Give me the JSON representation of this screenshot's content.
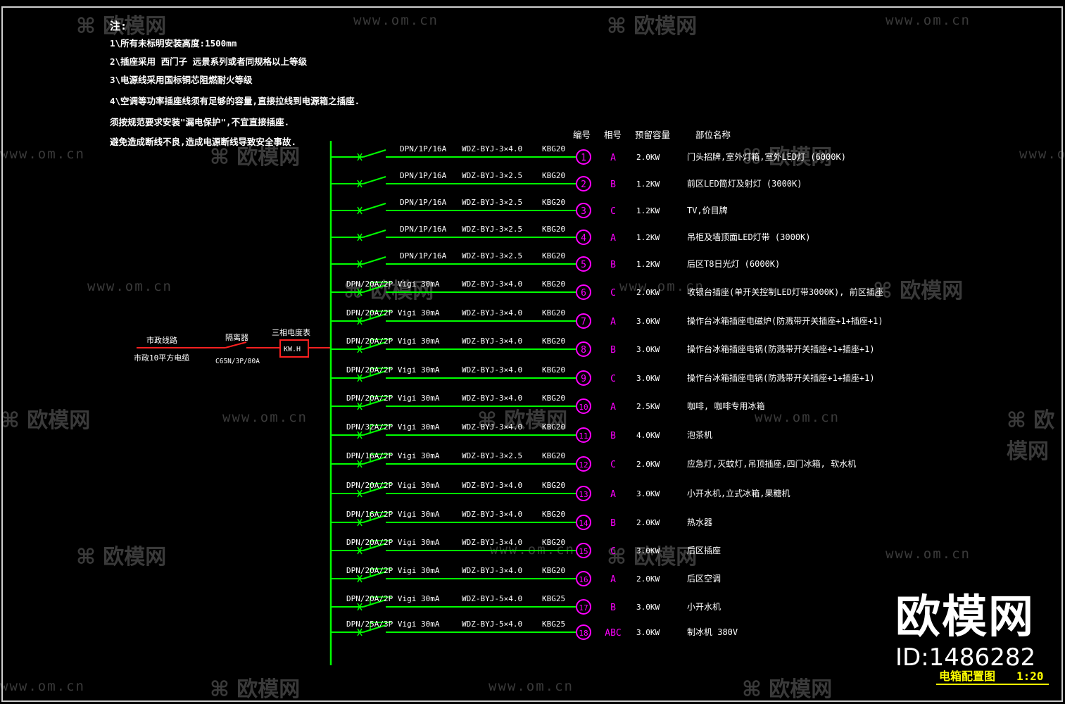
{
  "notes": {
    "heading": "注:",
    "lines": [
      "1\\所有未标明安装高度:1500mm",
      "2\\插座采用 西门子 远景系列或者同规格以上等级",
      "3\\电源线采用国标铜芯阻燃耐火等级",
      "4\\空调等功率插座线须有足够的容量,直接拉线到电源箱之插座.",
      "须按规范要求安装\"漏电保护\",不宜直接插座.",
      "避免造成断线不良,造成电源断线导致安全事故."
    ]
  },
  "headers": {
    "number": "编号",
    "phase": "相号",
    "capacity": "预留容量",
    "location": "部位名称"
  },
  "incoming": {
    "source_line1": "市政线路",
    "source_line2": "市政10平方电缆",
    "isolator": "隔离器",
    "isolator_spec": "C65N/3P/80A",
    "meter_label": "三相电度表",
    "meter_box": "KW.H"
  },
  "circuits": [
    {
      "breaker": "DPN/1P/16A",
      "cable": "WDZ-BYJ-3×4.0",
      "conduit": "KBG20",
      "num": "1",
      "phase": "A",
      "cap": "2.0KW",
      "desc": "门头招牌,室外灯箱,室外LED灯 (6000K)"
    },
    {
      "breaker": "DPN/1P/16A",
      "cable": "WDZ-BYJ-3×2.5",
      "conduit": "KBG20",
      "num": "2",
      "phase": "B",
      "cap": "1.2KW",
      "desc": "前区LED筒灯及射灯 (3000K)"
    },
    {
      "breaker": "DPN/1P/16A",
      "cable": "WDZ-BYJ-3×2.5",
      "conduit": "KBG20",
      "num": "3",
      "phase": "C",
      "cap": "1.2KW",
      "desc": "TV,价目牌"
    },
    {
      "breaker": "DPN/1P/16A",
      "cable": "WDZ-BYJ-3×2.5",
      "conduit": "KBG20",
      "num": "4",
      "phase": "A",
      "cap": "1.2KW",
      "desc": "吊柜及墙顶面LED灯带 (3000K)"
    },
    {
      "breaker": "DPN/1P/16A",
      "cable": "WDZ-BYJ-3×2.5",
      "conduit": "KBG20",
      "num": "5",
      "phase": "B",
      "cap": "1.2KW",
      "desc": "后区T8日光灯 (6000K)"
    },
    {
      "breaker": "DPN/20A/2P Vigi 30mA",
      "cable": "WDZ-BYJ-3×4.0",
      "conduit": "KBG20",
      "num": "6",
      "phase": "C",
      "cap": "2.0KW",
      "desc": "收银台插座(单开关控制LED灯带3000K), 前区插座"
    },
    {
      "breaker": "DPN/20A/2P Vigi 30mA",
      "cable": "WDZ-BYJ-3×4.0",
      "conduit": "KBG20",
      "num": "7",
      "phase": "A",
      "cap": "3.0KW",
      "desc": "操作台冰箱插座电磁炉(防溅带开关插座+1+插座+1)"
    },
    {
      "breaker": "DPN/20A/2P Vigi 30mA",
      "cable": "WDZ-BYJ-3×4.0",
      "conduit": "KBG20",
      "num": "8",
      "phase": "B",
      "cap": "3.0KW",
      "desc": "操作台冰箱插座电锅(防溅带开关插座+1+插座+1)"
    },
    {
      "breaker": "DPN/20A/2P Vigi 30mA",
      "cable": "WDZ-BYJ-3×4.0",
      "conduit": "KBG20",
      "num": "9",
      "phase": "C",
      "cap": "3.0KW",
      "desc": "操作台冰箱插座电锅(防溅带开关插座+1+插座+1)"
    },
    {
      "breaker": "DPN/20A/2P Vigi 30mA",
      "cable": "WDZ-BYJ-3×4.0",
      "conduit": "KBG20",
      "num": "10",
      "phase": "A",
      "cap": "2.5KW",
      "desc": "咖啡, 咖啡专用冰箱"
    },
    {
      "breaker": "DPN/32A/2P Vigi 30mA",
      "cable": "WDZ-BYJ-3×4.0",
      "conduit": "KBG20",
      "num": "11",
      "phase": "B",
      "cap": "4.0KW",
      "desc": "泡茶机"
    },
    {
      "breaker": "DPN/16A/2P Vigi 30mA",
      "cable": "WDZ-BYJ-3×2.5",
      "conduit": "KBG20",
      "num": "12",
      "phase": "C",
      "cap": "2.0KW",
      "desc": "应急灯,灭蚊灯,吊顶插座,四门冰箱, 软水机"
    },
    {
      "breaker": "DPN/20A/2P Vigi 30mA",
      "cable": "WDZ-BYJ-3×4.0",
      "conduit": "KBG20",
      "num": "13",
      "phase": "A",
      "cap": "3.0KW",
      "desc": "小开水机,立式冰箱,果糖机"
    },
    {
      "breaker": "DPN/16A/2P Vigi 30mA",
      "cable": "WDZ-BYJ-3×4.0",
      "conduit": "KBG20",
      "num": "14",
      "phase": "B",
      "cap": "2.0KW",
      "desc": "热水器"
    },
    {
      "breaker": "DPN/20A/2P Vigi 30mA",
      "cable": "WDZ-BYJ-3×4.0",
      "conduit": "KBG20",
      "num": "15",
      "phase": "C",
      "cap": "3.0KW",
      "desc": "后区插座"
    },
    {
      "breaker": "DPN/20A/2P Vigi 30mA",
      "cable": "WDZ-BYJ-3×4.0",
      "conduit": "KBG20",
      "num": "16",
      "phase": "A",
      "cap": "2.0KW",
      "desc": "后区空调"
    },
    {
      "breaker": "DPN/20A/2P Vigi 30mA",
      "cable": "WDZ-BYJ-5×4.0",
      "conduit": "KBG25",
      "num": "17",
      "phase": "B",
      "cap": "3.0KW",
      "desc": "小开水机"
    },
    {
      "breaker": "DPN/25A/3P Vigi 30mA",
      "cable": "WDZ-BYJ-5×4.0",
      "conduit": "KBG25",
      "num": "18",
      "phase": "ABC",
      "cap": "3.0KW",
      "desc": "制冰机 380V"
    }
  ],
  "title_block": {
    "title": "电箱配置图",
    "scale": "1:20"
  },
  "brand": {
    "name": "欧模网",
    "id": "ID:1486282"
  },
  "watermark": {
    "cn": "欧模网",
    "url": "www.om.cn"
  },
  "colors": {
    "background": "#000000",
    "wire_green": "#00ff00",
    "wire_red": "#ff2020",
    "circle_magenta": "#ff00ff",
    "text_white": "#ffffff",
    "title_yellow": "#ffff00"
  }
}
